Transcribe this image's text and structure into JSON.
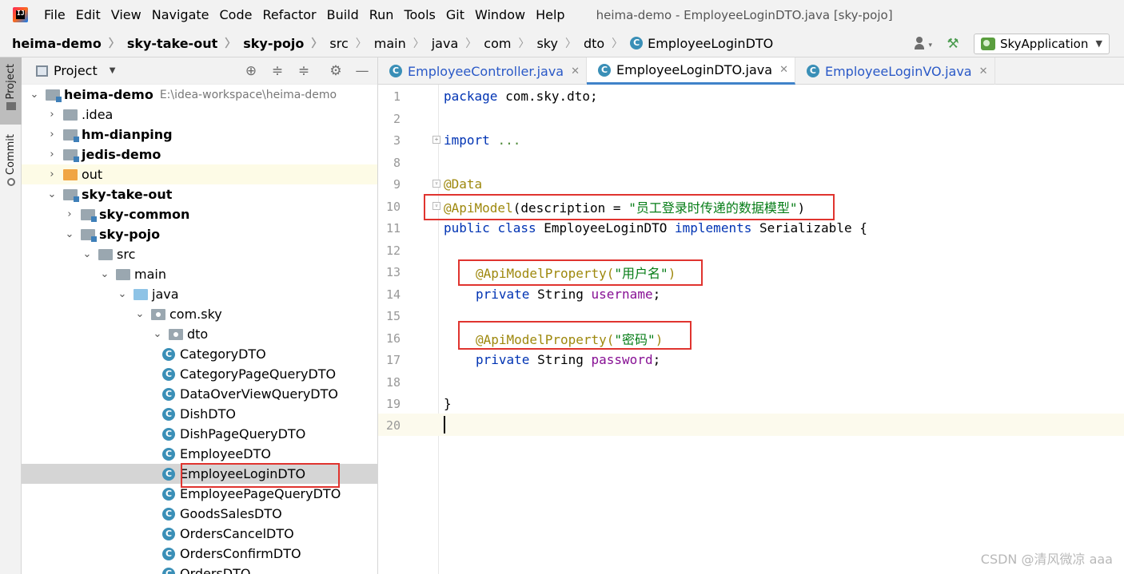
{
  "menubar": {
    "app_icon": "intellij-idea-icon",
    "items": [
      "File",
      "Edit",
      "View",
      "Navigate",
      "Code",
      "Refactor",
      "Build",
      "Run",
      "Tools",
      "Git",
      "Window",
      "Help"
    ],
    "window_title": "heima-demo - EmployeeLoginDTO.java [sky-pojo]"
  },
  "breadcrumb": {
    "items": [
      "heima-demo",
      "sky-take-out",
      "sky-pojo",
      "src",
      "main",
      "java",
      "com",
      "sky",
      "dto"
    ],
    "file": "EmployeeLoginDTO"
  },
  "toolbar": {
    "run_config": "SkyApplication",
    "icons": [
      "user-icon",
      "hammer-icon",
      "run-config-icon"
    ]
  },
  "side_tabs": {
    "project": "Project",
    "commit": "Commit"
  },
  "project_panel": {
    "title": "Project",
    "tools": [
      "target-icon",
      "expand-all-icon",
      "collapse-all-icon",
      "gear-icon",
      "hide-icon"
    ],
    "tree": [
      {
        "label": "heima-demo",
        "path": "E:\\idea-workspace\\heima-demo",
        "depth": 0,
        "expanded": true,
        "kind": "module",
        "bold": true
      },
      {
        "label": ".idea",
        "depth": 1,
        "expanded": false,
        "kind": "folder"
      },
      {
        "label": "hm-dianping",
        "depth": 1,
        "expanded": false,
        "kind": "module",
        "bold": true
      },
      {
        "label": "jedis-demo",
        "depth": 1,
        "expanded": false,
        "kind": "module",
        "bold": true
      },
      {
        "label": "out",
        "depth": 1,
        "expanded": false,
        "kind": "folder-orange"
      },
      {
        "label": "sky-take-out",
        "depth": 1,
        "expanded": true,
        "kind": "module",
        "bold": true
      },
      {
        "label": "sky-common",
        "depth": 2,
        "expanded": false,
        "kind": "module",
        "bold": true
      },
      {
        "label": "sky-pojo",
        "depth": 2,
        "expanded": true,
        "kind": "module",
        "bold": true
      },
      {
        "label": "src",
        "depth": 3,
        "expanded": true,
        "kind": "folder"
      },
      {
        "label": "main",
        "depth": 4,
        "expanded": true,
        "kind": "folder"
      },
      {
        "label": "java",
        "depth": 5,
        "expanded": true,
        "kind": "folder-blue"
      },
      {
        "label": "com.sky",
        "depth": 6,
        "expanded": true,
        "kind": "package"
      },
      {
        "label": "dto",
        "depth": 7,
        "expanded": true,
        "kind": "package"
      },
      {
        "label": "CategoryDTO",
        "depth": 8,
        "kind": "class"
      },
      {
        "label": "CategoryPageQueryDTO",
        "depth": 8,
        "kind": "class"
      },
      {
        "label": "DataOverViewQueryDTO",
        "depth": 8,
        "kind": "class"
      },
      {
        "label": "DishDTO",
        "depth": 8,
        "kind": "class"
      },
      {
        "label": "DishPageQueryDTO",
        "depth": 8,
        "kind": "class"
      },
      {
        "label": "EmployeeDTO",
        "depth": 8,
        "kind": "class"
      },
      {
        "label": "EmployeeLoginDTO",
        "depth": 8,
        "kind": "class",
        "selected": true
      },
      {
        "label": "EmployeePageQueryDTO",
        "depth": 8,
        "kind": "class"
      },
      {
        "label": "GoodsSalesDTO",
        "depth": 8,
        "kind": "class"
      },
      {
        "label": "OrdersCancelDTO",
        "depth": 8,
        "kind": "class"
      },
      {
        "label": "OrdersConfirmDTO",
        "depth": 8,
        "kind": "class"
      },
      {
        "label": "OrdersDTO",
        "depth": 8,
        "kind": "class"
      }
    ]
  },
  "editor_tabs": [
    {
      "label": "EmployeeController.java",
      "active": false
    },
    {
      "label": "EmployeeLoginDTO.java",
      "active": true
    },
    {
      "label": "EmployeeLoginVO.java",
      "active": false
    }
  ],
  "code": {
    "package_kw": "package",
    "package_name": "com.sky.dto;",
    "import_kw": "import",
    "import_dots": "...",
    "data_ann": "@Data",
    "apimodel_ann": "@ApiModel",
    "apimodel_args_open": "(description = ",
    "apimodel_desc": "\"员工登录时传递的数据模型\"",
    "paren_close": ")",
    "public_kw": "public",
    "class_kw": "class",
    "class_name": "EmployeeLoginDTO",
    "implements_kw": "implements",
    "interface_name": "Serializable",
    "brace_open": "{",
    "prop_ann": "@ApiModelProperty",
    "username_desc": "\"用户名\"",
    "password_desc": "\"密码\"",
    "private_kw": "private",
    "string_type": "String",
    "username_field": "username",
    "password_field": "password",
    "semicolon": ";",
    "brace_close": "}",
    "line_numbers": [
      "1",
      "2",
      "3",
      "8",
      "9",
      "10",
      "11",
      "12",
      "13",
      "14",
      "15",
      "16",
      "17",
      "18",
      "19",
      "20"
    ]
  },
  "watermark": "CSDN @清风微凉 aaa",
  "colors": {
    "keyword": "#0033b3",
    "annotation": "#9e880d",
    "string": "#067d17",
    "field": "#871094",
    "highlight_box": "#e0342f"
  }
}
